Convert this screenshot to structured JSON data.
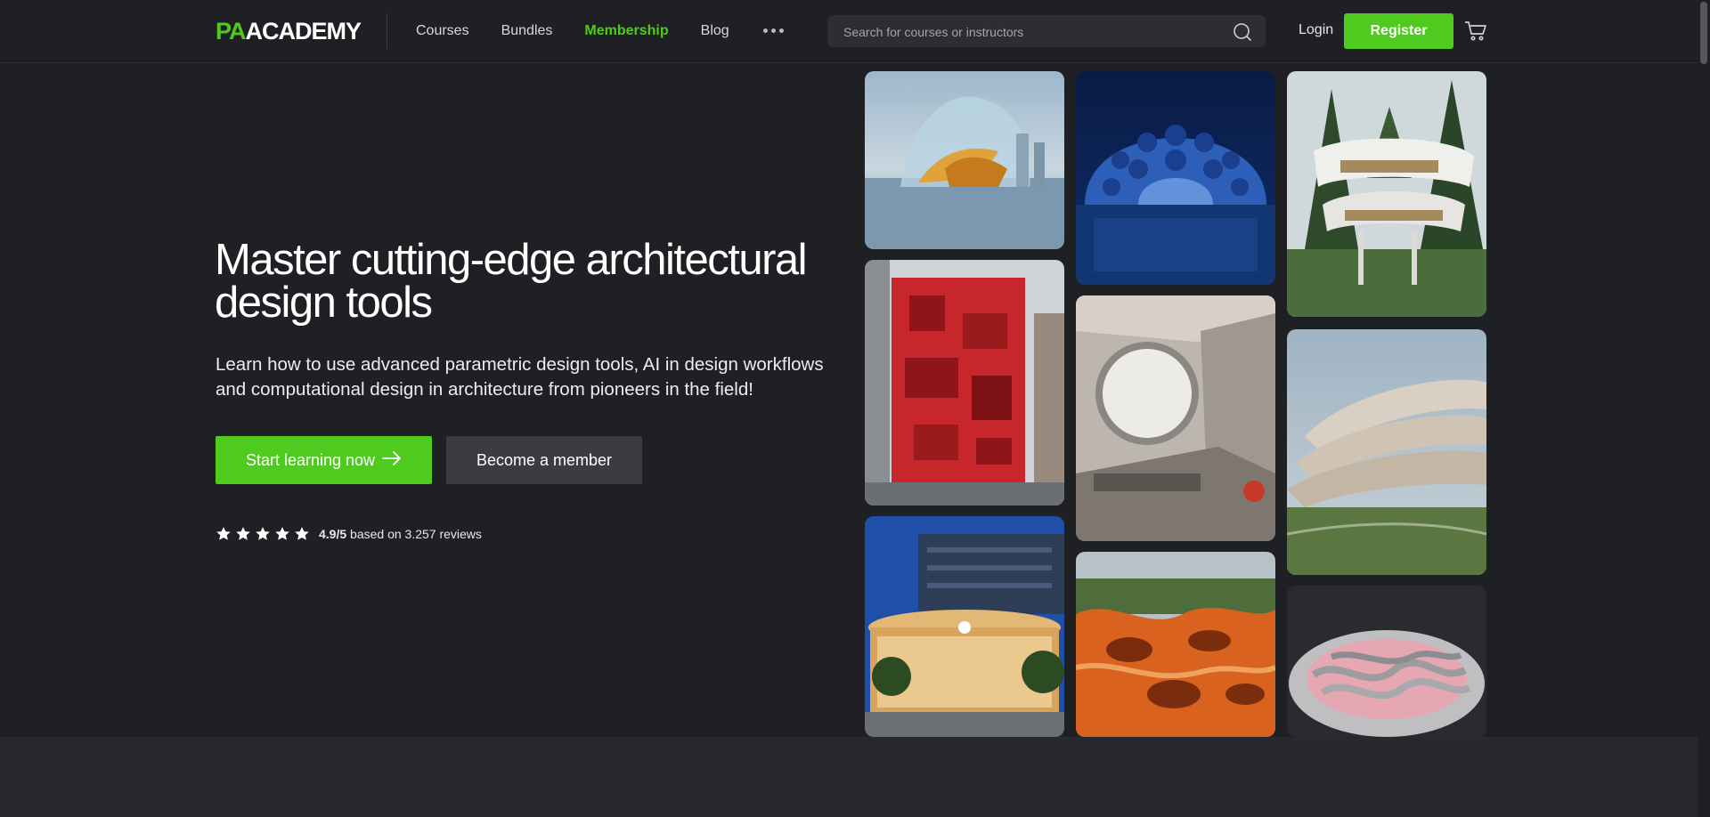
{
  "header": {
    "logo_pa": "PA",
    "logo_academy": "ACADEMY",
    "nav": [
      {
        "label": "Courses"
      },
      {
        "label": "Bundles"
      },
      {
        "label": "Membership",
        "active": true
      },
      {
        "label": "Blog"
      }
    ],
    "search_placeholder": "Search for courses or instructors",
    "login_label": "Login",
    "register_label": "Register"
  },
  "hero": {
    "title_line1": "Master cutting-edge architectural",
    "title_line2": "design tools",
    "subtitle_line1": "Learn how to use advanced parametric design tools, AI in design workflows",
    "subtitle_line2": "and computational design in architecture from pioneers in the field!",
    "start_button": "Start learning now",
    "member_button": "Become a member",
    "rating_value": "4.9/5",
    "rating_text": "based on 3.257 reviews",
    "stars": 5
  },
  "gallery": [
    {
      "name": "glass-pavilion"
    },
    {
      "name": "red-cube-tower"
    },
    {
      "name": "glass-rotunda-store"
    },
    {
      "name": "blue-dome"
    },
    {
      "name": "futuristic-interior"
    },
    {
      "name": "orange-playscape"
    },
    {
      "name": "treehouse-villa"
    },
    {
      "name": "curved-terraces"
    },
    {
      "name": "layered-sculpture"
    }
  ],
  "colors": {
    "accent": "#4fcb1f",
    "background": "#1f2024",
    "secondary_button": "#3a3c41"
  }
}
